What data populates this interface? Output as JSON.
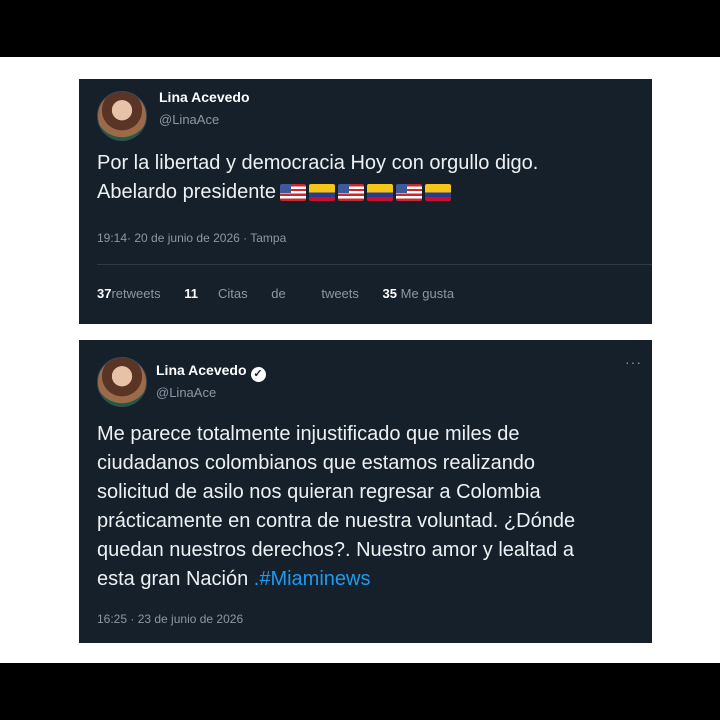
{
  "tweet1": {
    "name": "Lina Acevedo",
    "handle": "@LinaAce",
    "text_line1": "Por la libertad y democracia Hoy con orgullo digo.",
    "text_line2": "Abelardo presidente",
    "flags": [
      "us-flag",
      "colombia-flag",
      "us-flag",
      "colombia-flag",
      "us-flag",
      "colombia-flag"
    ],
    "meta": "19:14· 20 de junio de 2026 · Tampa",
    "retweets_count": "37",
    "retweets_label": "retweets",
    "citas_count": "11",
    "citas_label": "Citas",
    "de_label": "de",
    "tweets_label": "tweets",
    "likes_count": "35",
    "likes_label": "Me gusta"
  },
  "tweet2": {
    "name": "Lina Acevedo",
    "handle": "@LinaAce",
    "more": "···",
    "lines": [
      "Me parece totalmente injustificado que miles de",
      "ciudadanos colombianos que estamos realizando",
      "solicitud de asilo nos quieran regresar a Colombia",
      "prácticamente en contra de nuestra voluntad. ¿Dónde",
      "quedan nuestros derechos?. Nuestro amor y lealtad a"
    ],
    "last_line_text": "esta gran Nación",
    "hashtag": ".#Miaminews",
    "meta": "16:25 · 23 de junio de 2026"
  },
  "colors": {
    "tweet_bg": "#15202b",
    "hashtag": "#1d9bf0",
    "muted": "#8b98a5"
  }
}
